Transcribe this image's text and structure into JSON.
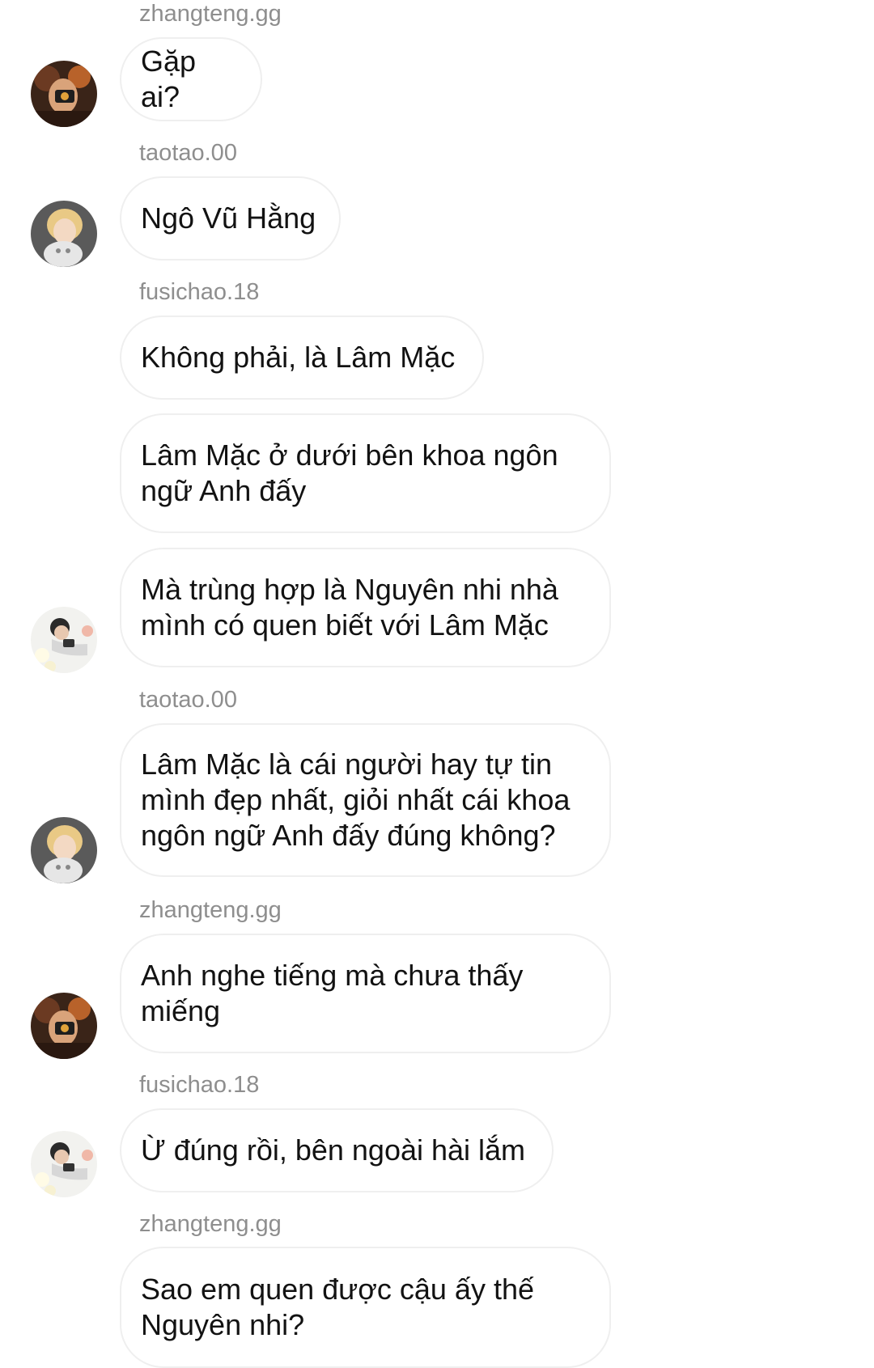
{
  "messages": [
    {
      "sender": "zhangteng.gg",
      "text": "Gặp ai?"
    },
    {
      "sender": "taotao.00",
      "text": "Ngô Vũ Hằng"
    },
    {
      "sender": "fusichao.18",
      "text": "Không phải, là Lâm Mặc"
    },
    {
      "sender": "",
      "text": "Lâm Mặc ở dưới bên khoa ngôn ngữ Anh đấy"
    },
    {
      "sender": "",
      "text": "Mà trùng hợp là Nguyên nhi nhà mình có quen biết với Lâm Mặc"
    },
    {
      "sender": "taotao.00",
      "text": "Lâm Mặc là cái người hay tự tin mình đẹp nhất, giỏi nhất cái khoa ngôn ngữ Anh đấy đúng không?"
    },
    {
      "sender": "zhangteng.gg",
      "text": "Anh nghe tiếng mà chưa thấy miếng"
    },
    {
      "sender": "fusichao.18",
      "text": "Ừ đúng rồi, bên ngoài hài lắm"
    },
    {
      "sender": "zhangteng.gg",
      "text": "Sao em quen được cậu ấy thế Nguyên nhi?"
    }
  ],
  "colors": {
    "sender_text": "#8e8e8e",
    "message_text": "#121212",
    "bubble_border": "#efefef",
    "background": "#ffffff"
  }
}
